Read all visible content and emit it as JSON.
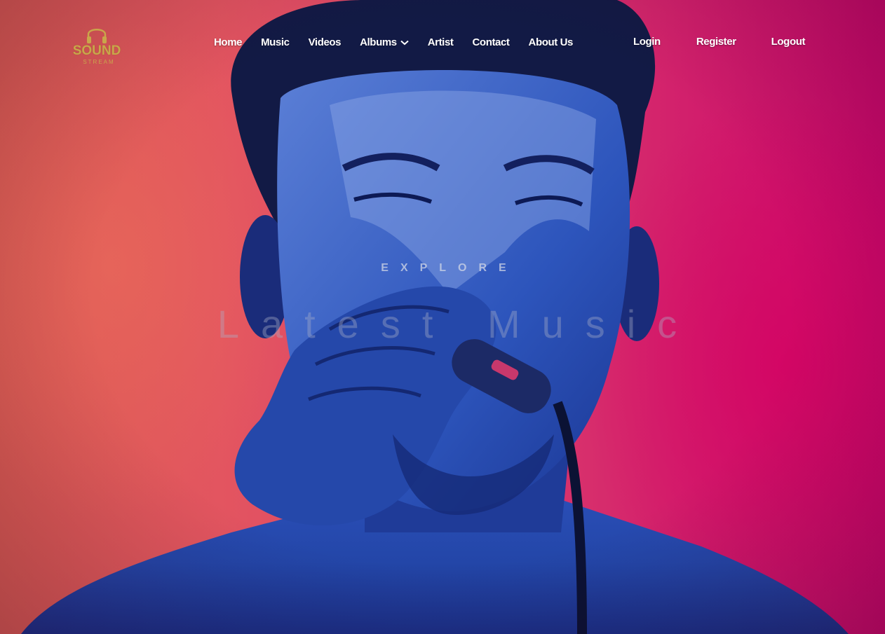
{
  "brand": {
    "logo_word": "SOUND",
    "logo_sub": "STREAM",
    "logo_icon": "headphones-icon",
    "logo_color": "#c9a64a"
  },
  "nav": {
    "items": [
      {
        "label": "Home"
      },
      {
        "label": "Music"
      },
      {
        "label": "Videos"
      },
      {
        "label": "Albums",
        "has_dropdown": true
      },
      {
        "label": "Artist"
      },
      {
        "label": "Contact"
      },
      {
        "label": "About Us"
      }
    ],
    "dropdown_icon": "chevron-down-icon"
  },
  "auth": {
    "login": "Login",
    "register": "Register",
    "logout": "Logout"
  },
  "hero": {
    "eyebrow": "EXPLORE",
    "headline": "Latest Music",
    "background_image": "singer-with-microphone-photo",
    "colors": {
      "background_left": "#d95a52",
      "background_right": "#c8086a",
      "figure_tint": "#1f3fa8"
    }
  }
}
